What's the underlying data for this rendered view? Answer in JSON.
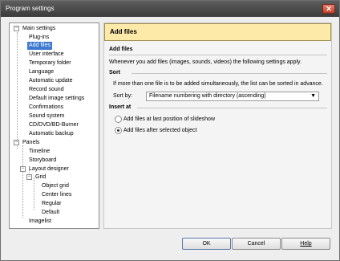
{
  "window": {
    "title": "Program settings",
    "close_glyph": "✕"
  },
  "tree": {
    "items": [
      {
        "label": "Main settings",
        "toggle": "−"
      },
      {
        "label": "Plug-ins"
      },
      {
        "label": "Add files"
      },
      {
        "label": "User interface"
      },
      {
        "label": "Temporary folder"
      },
      {
        "label": "Language"
      },
      {
        "label": "Automatic update"
      },
      {
        "label": "Record sound"
      },
      {
        "label": "Default image settings"
      },
      {
        "label": "Confirmations"
      },
      {
        "label": "Sound system"
      },
      {
        "label": "CD/DVD/BD-Burner"
      },
      {
        "label": "Automatic backup"
      },
      {
        "label": "Panels",
        "toggle": "−"
      },
      {
        "label": "Timeline"
      },
      {
        "label": "Storyboard"
      },
      {
        "label": "Layout designer",
        "toggle": "−"
      },
      {
        "label": "Grid",
        "toggle": "−"
      },
      {
        "label": "Object grid"
      },
      {
        "label": "Center lines"
      },
      {
        "label": "Regular"
      },
      {
        "label": "Default"
      },
      {
        "label": "Imagelist"
      }
    ],
    "selected": "Add files"
  },
  "panel": {
    "header": "Add files",
    "section_title": "Add files",
    "description": "Whenever you add files (images, sounds, videos) the following settings apply.",
    "sort": {
      "title": "Sort",
      "description": "If more than one file is to be added simultaneously, the list can be sorted in advance.",
      "label": "Sort by:",
      "value": "Filename numbering with directory (ascending)",
      "arrow": "▼"
    },
    "insert": {
      "title": "Insert at",
      "options": [
        {
          "label": "Add files at last position of slideshow",
          "checked": false
        },
        {
          "label": "Add files after selected object",
          "checked": true
        }
      ]
    }
  },
  "buttons": {
    "ok": "OK",
    "cancel": "Cancel",
    "help": "Help"
  }
}
